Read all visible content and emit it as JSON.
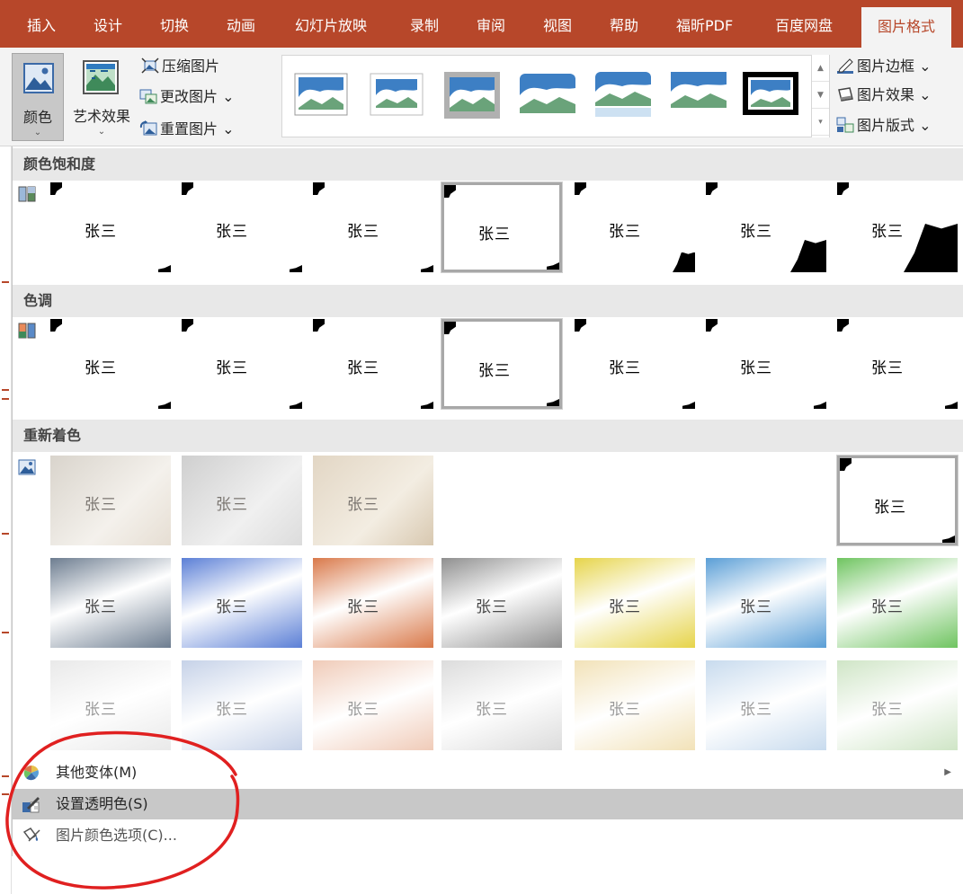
{
  "tabs": [
    {
      "label": "插入",
      "active": false
    },
    {
      "label": "设计",
      "active": false
    },
    {
      "label": "切换",
      "active": false
    },
    {
      "label": "动画",
      "active": false
    },
    {
      "label": "幻灯片放映",
      "active": false
    },
    {
      "label": "录制",
      "active": false
    },
    {
      "label": "审阅",
      "active": false
    },
    {
      "label": "视图",
      "active": false
    },
    {
      "label": "帮助",
      "active": false
    },
    {
      "label": "福昕PDF",
      "active": false
    },
    {
      "label": "百度网盘",
      "active": false
    },
    {
      "label": "图片格式",
      "active": true
    }
  ],
  "ribbon": {
    "color_label": "颜色",
    "color_chevron": "⌄",
    "artistic_label": "艺术效果",
    "artistic_chevron": "⌄",
    "compress_label": "压缩图片",
    "change_label": "更改图片 ⌄",
    "reset_label": "重置图片 ⌄",
    "border_label": "图片边框 ⌄",
    "effects_label": "图片效果 ⌄",
    "layout_label": "图片版式 ⌄",
    "scroll_up": "▲",
    "scroll_down": "▼",
    "scroll_more": "▾"
  },
  "sections": {
    "saturation": "颜色饱和度",
    "tone": "色调",
    "recolor": "重新着色"
  },
  "signature_text": "张三",
  "recolor_row2_colors": [
    "#6d7d90",
    "#5b7fd6",
    "#d9794a",
    "#8f8f8f",
    "#e6d44a",
    "#5a9ed6",
    "#6fc460"
  ],
  "recolor_row3_colors": [
    "#e9e9e9",
    "#c6d2e8",
    "#f0cbb8",
    "#dcdcdc",
    "#f2e2b8",
    "#c8dbee",
    "#cfe5c6"
  ],
  "menu": {
    "more_variants": "其他变体(M)",
    "set_transparent": "设置透明色(S)",
    "color_options": "图片颜色选项(C)...",
    "submenu_arrow": "▶"
  },
  "colors": {
    "accent": "#b7472a",
    "annotation": "#e02020"
  }
}
